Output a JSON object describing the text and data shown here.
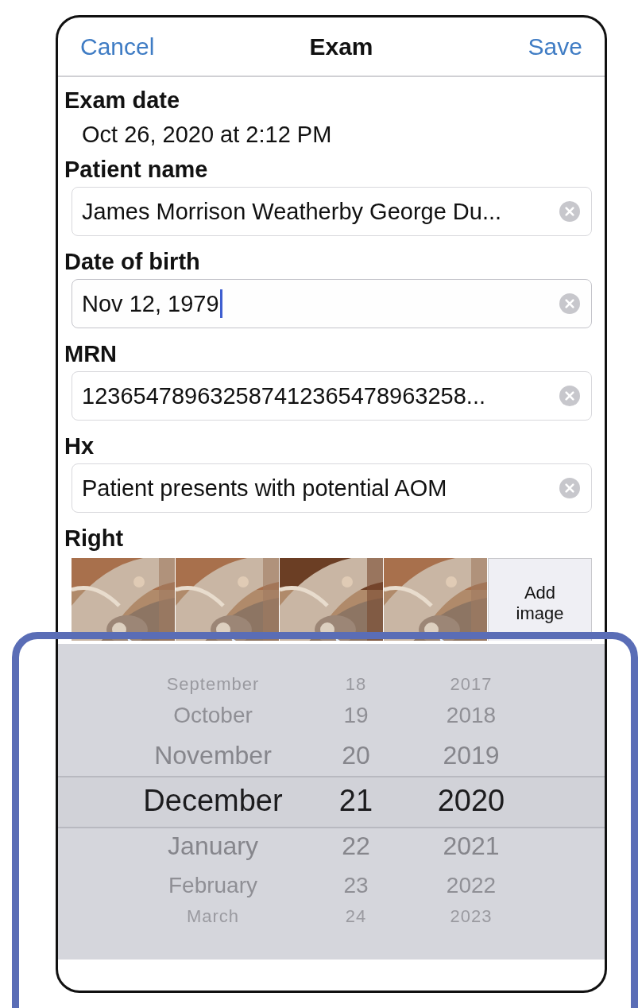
{
  "nav": {
    "cancel": "Cancel",
    "title": "Exam",
    "save": "Save"
  },
  "exam_date": {
    "label": "Exam date",
    "value": "Oct 26, 2020 at 2:12 PM"
  },
  "fields": [
    {
      "label": "Patient name",
      "value": "James Morrison Weatherby George Du...",
      "focused": false
    },
    {
      "label": "Date of birth",
      "value": "Nov 12, 1979",
      "focused": true
    },
    {
      "label": "MRN",
      "value": "123654789632587412365478963258...",
      "focused": false
    },
    {
      "label": "Hx",
      "value": "Patient presents with potential AOM",
      "focused": false
    }
  ],
  "images": {
    "label": "Right",
    "add_label": "Add image"
  },
  "picker": {
    "columns": [
      {
        "items": [
          {
            "label": "September",
            "selected": false
          },
          {
            "label": "October",
            "selected": false
          },
          {
            "label": "November",
            "selected": false
          },
          {
            "label": "December",
            "selected": true
          },
          {
            "label": "January",
            "selected": false
          },
          {
            "label": "February",
            "selected": false
          },
          {
            "label": "March",
            "selected": false
          }
        ]
      },
      {
        "items": [
          {
            "label": "18",
            "selected": false
          },
          {
            "label": "19",
            "selected": false
          },
          {
            "label": "20",
            "selected": false
          },
          {
            "label": "21",
            "selected": true
          },
          {
            "label": "22",
            "selected": false
          },
          {
            "label": "23",
            "selected": false
          },
          {
            "label": "24",
            "selected": false
          }
        ]
      },
      {
        "items": [
          {
            "label": "2017",
            "selected": false
          },
          {
            "label": "2018",
            "selected": false
          },
          {
            "label": "2019",
            "selected": false
          },
          {
            "label": "2020",
            "selected": true
          },
          {
            "label": "2021",
            "selected": false
          },
          {
            "label": "2022",
            "selected": false
          },
          {
            "label": "2023",
            "selected": false
          }
        ]
      }
    ]
  }
}
